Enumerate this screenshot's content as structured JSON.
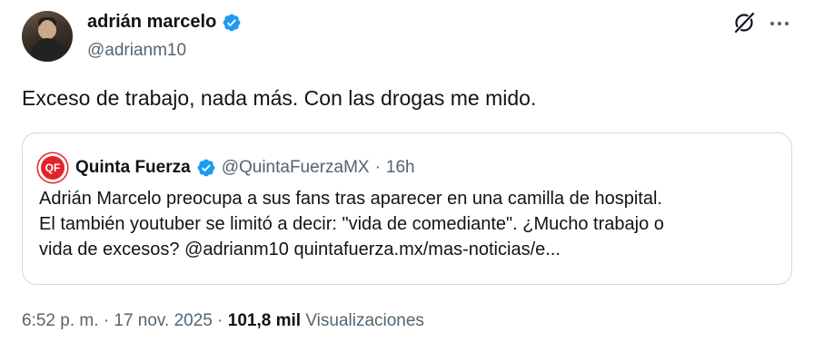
{
  "author": {
    "display_name": "adrián marcelo",
    "handle": "@adrianm10",
    "verified": true
  },
  "tweet": {
    "text": "Exceso de trabajo, nada más. Con las drogas me mido."
  },
  "quoted": {
    "avatar_text": "QF",
    "display_name": "Quinta Fuerza",
    "handle": "@QuintaFuerzaMX",
    "separator": "·",
    "time": "16h",
    "lines": [
      "Adrián Marcelo preocupa a sus fans tras aparecer en una camilla de hospital.",
      "El también youtuber se limitó a decir: \"vida de comediante\". ¿Mucho trabajo o",
      "vida de excesos? @adrianm10 quintafuerza.mx/mas-noticias/e..."
    ]
  },
  "meta": {
    "time": "6:52 p. m.",
    "separator": "·",
    "date": "17 nov. 2025",
    "views_count": "101,8 mil",
    "views_label": "Visualizaciones"
  },
  "colors": {
    "verified": "#1d9bf0",
    "secondary_text": "#536471",
    "border": "#cfd9de",
    "brand_red": "#e3232a"
  },
  "icons": {
    "grok": "grok-icon",
    "more": "more-horizontal-icon"
  }
}
